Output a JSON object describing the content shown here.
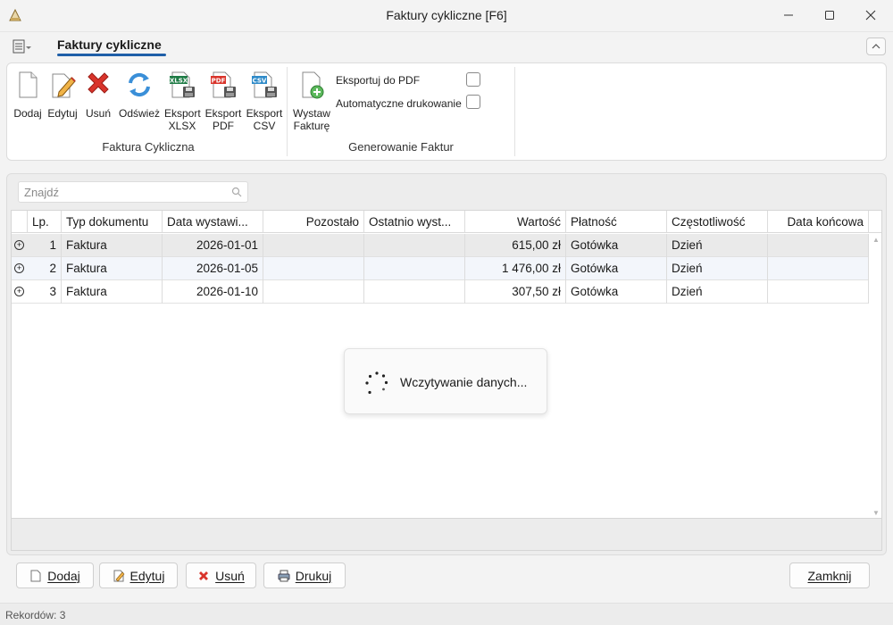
{
  "window": {
    "title": "Faktury cykliczne [F6]"
  },
  "ribbon": {
    "tab": "Faktury cykliczne",
    "groups": [
      {
        "label": "Faktura Cykliczna"
      },
      {
        "label": "Generowanie Faktur"
      }
    ],
    "buttons": {
      "add": "Dodaj",
      "edit": "Edytuj",
      "delete": "Usuń",
      "refresh": "Odśwież",
      "export_xlsx_1": "Eksport",
      "export_xlsx_2": "XLSX",
      "export_pdf_1": "Eksport",
      "export_pdf_2": "PDF",
      "export_csv_1": "Eksport",
      "export_csv_2": "CSV",
      "issue_1": "Wystaw",
      "issue_2": "Fakturę"
    },
    "options": {
      "export_pdf": "Eksportuj do PDF",
      "auto_print": "Automatyczne drukowanie"
    },
    "icon_text": {
      "xlsx": "XLSX",
      "pdf": "PDF",
      "csv": "CSV"
    }
  },
  "search": {
    "placeholder": "Znajdź",
    "value": ""
  },
  "grid": {
    "columns": [
      "Lp.",
      "Typ dokumentu",
      "Data wystawi...",
      "Pozostało",
      "Ostatnio wyst...",
      "Wartość",
      "Płatność",
      "Częstotliwość",
      "Data końcowa"
    ],
    "rows": [
      {
        "lp": "1",
        "typ": "Faktura",
        "data": "2026-01-01",
        "pozostalo": "",
        "ostatnio": "",
        "wartosc": "615,00 zł",
        "platnosc": "Gotówka",
        "czestotliwosc": "Dzień",
        "data_koncowa": ""
      },
      {
        "lp": "2",
        "typ": "Faktura",
        "data": "2026-01-05",
        "pozostalo": "",
        "ostatnio": "",
        "wartosc": "1 476,00 zł",
        "platnosc": "Gotówka",
        "czestotliwosc": "Dzień",
        "data_koncowa": ""
      },
      {
        "lp": "3",
        "typ": "Faktura",
        "data": "2026-01-10",
        "pozostalo": "",
        "ostatnio": "",
        "wartosc": "307,50 zł",
        "platnosc": "Gotówka",
        "czestotliwosc": "Dzień",
        "data_koncowa": ""
      }
    ]
  },
  "loading": {
    "text": "Wczytywanie danych..."
  },
  "actions": {
    "add": "Dodaj",
    "edit": "Edytuj",
    "delete": "Usuń",
    "print": "Drukuj",
    "close": "Zamknij"
  },
  "status": {
    "records": "Rekordów: 3"
  },
  "colors": {
    "accent": "#1f5fa8",
    "delete_red": "#d9342b",
    "selected_row": "#eaeaea"
  }
}
